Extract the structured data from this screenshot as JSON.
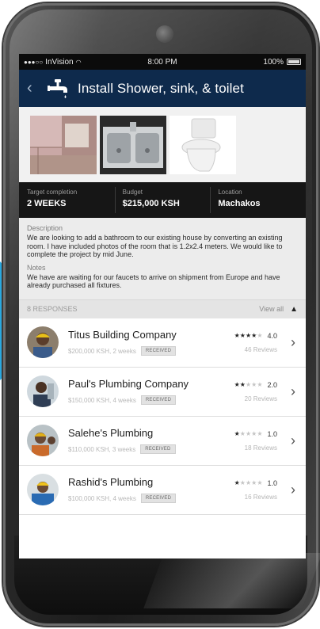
{
  "status_bar": {
    "carrier": "InVision",
    "time": "8:00 PM",
    "battery": "100%"
  },
  "header": {
    "back": "‹",
    "title": "Install Shower, sink, & toilet"
  },
  "stats": [
    {
      "label": "Target completion",
      "value": "2 WEEKS"
    },
    {
      "label": "Budget",
      "value": "$215,000 KSH"
    },
    {
      "label": "Location",
      "value": "Machakos"
    }
  ],
  "details": {
    "description_label": "Description",
    "description": "We are looking to add a bathroom to our existing house by converting an existing room. I have included photos of the room that is 1.2x2.4 meters. We would like to complete the project by mid June.",
    "notes_label": "Notes",
    "notes": "We have are waiting for our faucets to arrive on shipment from Europe and have already purchased all fixtures."
  },
  "responses": {
    "count_label": "8 RESPONSES",
    "view_all": "View all",
    "items": [
      {
        "name": "Titus Building Company",
        "meta": "$200,000 KSH, 2 weeks",
        "badge": "RECEIVED",
        "stars": 4,
        "score": "4.0",
        "reviews": "46 Reviews"
      },
      {
        "name": "Paul's Plumbing Company",
        "meta": "$150,000 KSH, 4 weeks",
        "badge": "RECEIVED",
        "stars": 2,
        "score": "2.0",
        "reviews": "20 Reviews"
      },
      {
        "name": "Salehe's Plumbing",
        "meta": "$110,000 KSH, 3 weeks",
        "badge": "RECEIVED",
        "stars": 1,
        "score": "1.0",
        "reviews": "18 Reviews"
      },
      {
        "name": "Rashid's Plumbing",
        "meta": "$100,000 KSH, 4 weeks",
        "badge": "RECEIVED",
        "stars": 1,
        "score": "1.0",
        "reviews": "16 Reviews"
      }
    ]
  },
  "colors": {
    "nav": "#0e2a4c",
    "arrow": "#29a8e0",
    "stats_bg": "#161616"
  }
}
